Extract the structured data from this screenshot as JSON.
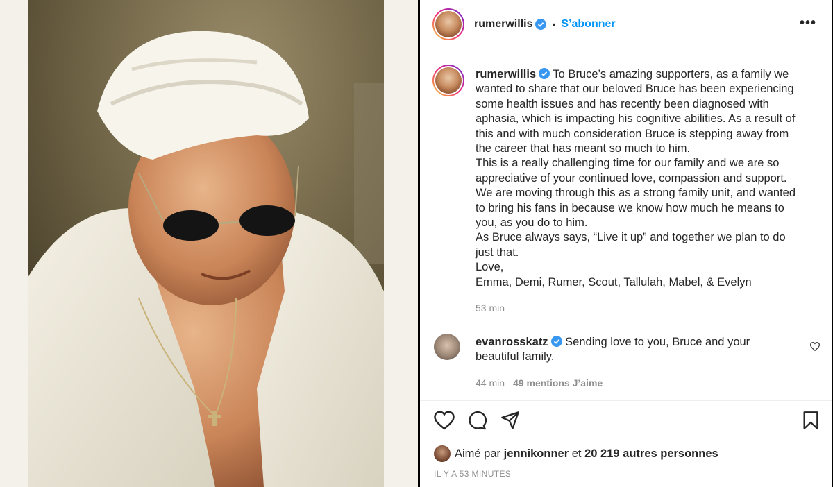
{
  "post": {
    "author": "rumerwillis",
    "follow_label": "S’abonner",
    "dot": "•",
    "more": "•••"
  },
  "caption": {
    "author": "rumerwillis",
    "lines": [
      "To Bruce’s amazing supporters, as a family we",
      "wanted to share that our beloved Bruce has been experiencing",
      "some health issues and has recently been diagnosed with",
      "aphasia, which is impacting his cognitive abilities. As a result of",
      "this and with much consideration Bruce is stepping away from",
      "the career that has meant so much to him.",
      "This is a really challenging time for our family and we are so",
      "appreciative of your continued love, compassion and support.",
      "We are moving through this as a strong family unit, and wanted",
      "to bring his fans in because we know how much he means to",
      "you, as you do to him.",
      "As Bruce always says, “Live it up” and together we plan to do",
      "just that.",
      "Love,",
      "Emma, Demi, Rumer, Scout, Tallulah, Mabel, & Evelyn"
    ],
    "time": "53 min"
  },
  "comment": {
    "author": "evanrosskatz",
    "line1": "Sending love to you, Bruce and your",
    "line2": "beautiful family.",
    "time": "44 min",
    "likes": "49 mentions J’aime"
  },
  "likes": {
    "prefix": "Aimé par",
    "user": "jennikonner",
    "middle": "et",
    "count": "20 219 autres personnes"
  },
  "timestamp": "IL Y A 53 MINUTES",
  "colors": {
    "accent": "#0095f6",
    "verified": "#3897f0",
    "muted": "#8e8e8e"
  }
}
